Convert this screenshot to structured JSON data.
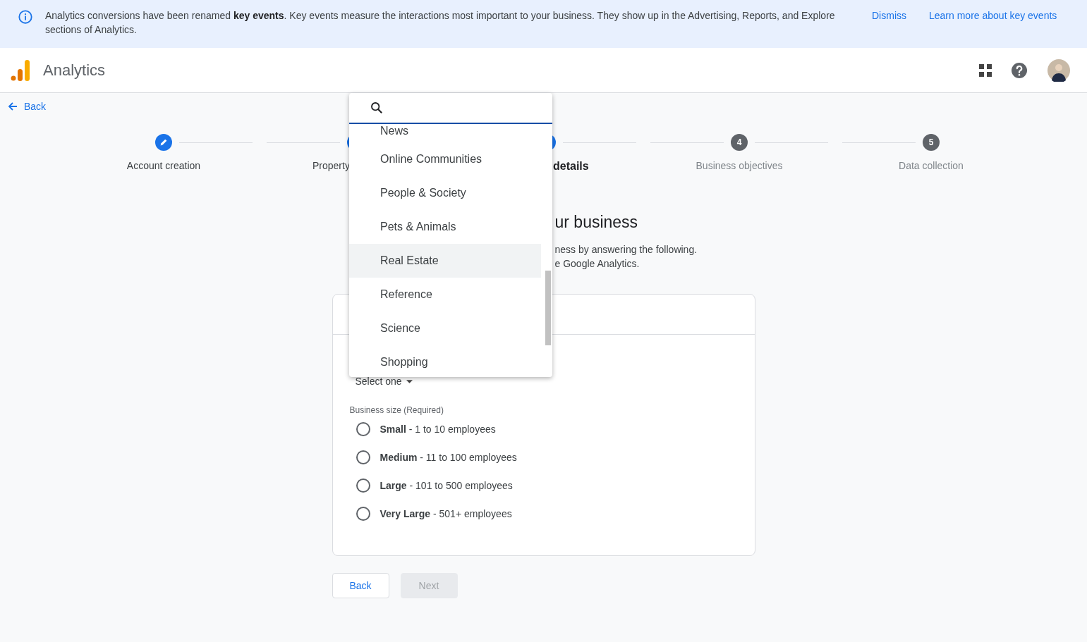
{
  "banner": {
    "text": "Analytics conversions have been renamed **key events**. Key events measure the interactions most important to your business. They show up in the Advertising, Reports, and Explore sections of Analytics.",
    "actions": [
      "Dismiss",
      "Learn more about key events"
    ]
  },
  "header": {
    "title": "Analytics"
  },
  "back_link": "Back",
  "stepper": [
    {
      "label": "Account creation",
      "kind": "done"
    },
    {
      "label": "Property",
      "kind": "done"
    },
    {
      "label": "details",
      "kind": "current"
    },
    {
      "label": "Business objectives",
      "kind": "todo",
      "number": "4"
    },
    {
      "label": "Data collection",
      "kind": "todo",
      "number": "5"
    }
  ],
  "intro": {
    "heading": "ur business",
    "lines": [
      "ness by answering the following.",
      "e Google Analytics."
    ]
  },
  "form": {
    "select": {
      "value": "Select one"
    },
    "size_label": "Business size (Required)",
    "sizes": [
      {
        "label": "**Small** - 1 to 10 employees",
        "selected": false
      },
      {
        "label": "**Medium** - 11 to 100 employees",
        "selected": false
      },
      {
        "label": "**Large** - 101 to 500 employees",
        "selected": false
      },
      {
        "label": "**Very Large** - 501+ employees",
        "selected": false
      }
    ]
  },
  "buttons": [
    {
      "label": "Back",
      "disabled": false
    },
    {
      "label": "Next",
      "disabled": true
    }
  ],
  "dropdown": {
    "items": [
      {
        "label": "News",
        "highlighted": false
      },
      {
        "label": "Online Communities",
        "highlighted": false
      },
      {
        "label": "People & Society",
        "highlighted": false
      },
      {
        "label": "Pets & Animals",
        "highlighted": false
      },
      {
        "label": "Real Estate",
        "highlighted": true
      },
      {
        "label": "Reference",
        "highlighted": false
      },
      {
        "label": "Science",
        "highlighted": false
      },
      {
        "label": "Shopping",
        "highlighted": false
      }
    ]
  }
}
